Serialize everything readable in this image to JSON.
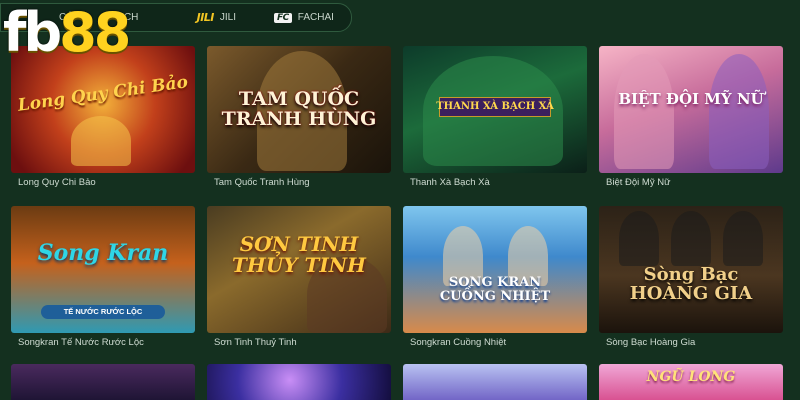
{
  "brand": {
    "logo_part1": "fb",
    "logo_part2": "88"
  },
  "provider_tabs": [
    {
      "label": "CÁ",
      "logo": ""
    },
    {
      "label": "ECH",
      "logo": ""
    },
    {
      "label": "JILI",
      "logo": "JILI"
    },
    {
      "label": "FACHAI",
      "logo": "FC"
    }
  ],
  "games": [
    {
      "caption": "Long Quy Chi Bảo",
      "art_title": "Long Quy Chi Bảo"
    },
    {
      "caption": "Tam Quốc Tranh Hùng",
      "art_title": "TAM QUỐC\nTRANH HÙNG"
    },
    {
      "caption": "Thanh Xà Bạch Xà",
      "art_title": "THANH XÀ BẠCH XÀ"
    },
    {
      "caption": "Biệt Đội Mỹ Nữ",
      "art_title": "BIỆT ĐỘI MỸ NỮ"
    },
    {
      "caption": "Songkran Tế Nước Rước Lộc",
      "art_title": "Song Kran",
      "art_subtitle": "TẾ NƯỚC RƯỚC LỘC"
    },
    {
      "caption": "Sơn Tinh Thuỷ Tinh",
      "art_title": "SƠN TINH\nTHỦY TINH"
    },
    {
      "caption": "Songkran Cuồng Nhiệt",
      "art_title": "SONG KRAN\nCUỒNG NHIỆT"
    },
    {
      "caption": "Sòng Bạc Hoàng Gia",
      "art_title": "Sòng Bạc\nHOÀNG GIA"
    }
  ],
  "partial_row": [
    {
      "art_title": ""
    },
    {
      "art_title": ""
    },
    {
      "art_title": ""
    },
    {
      "art_title": "NGŨ LONG"
    }
  ],
  "colors": {
    "background": "#14301f",
    "tab_bar": "#0f2619",
    "logo_yellow": "#ffd21f",
    "caption_text": "#cfdcd2"
  }
}
